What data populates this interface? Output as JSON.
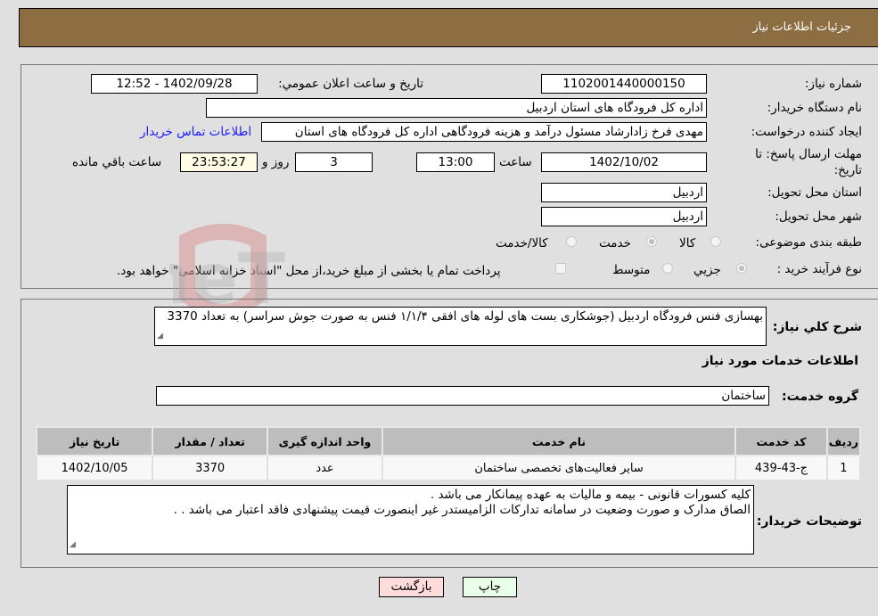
{
  "header": {
    "title": "جزئیات اطلاعات نیاز"
  },
  "fields": {
    "need_number_label": "شماره نیاز:",
    "need_number": "1102001440000150",
    "announce_label": "تاریخ و ساعت اعلان عمومي:",
    "announce_value": "1402/09/28 - 12:52",
    "buyer_org_label": "نام دستگاه خریدار:",
    "buyer_org": "اداره کل فرودگاه های استان اردبیل",
    "creator_label": "ایجاد کننده درخواست:",
    "creator": "مهدی فرخ زادارشاد مسئول درآمد و هزینه فرودگاهی اداره کل فرودگاه های استان",
    "contact_link": "اطلاعات تماس خریدار",
    "deadline_label": "مهلت ارسال پاسخ: تا تاریخ:",
    "deadline_date": "1402/10/02",
    "time_label": "ساعت",
    "deadline_time": "13:00",
    "days_value": "3",
    "days_label": "روز و",
    "remaining_time": "23:53:27",
    "remaining_label": "ساعت باقي مانده",
    "province_label": "استان محل تحویل:",
    "province": "اردبیل",
    "city_label": "شهر محل تحویل:",
    "city": "اردبیل",
    "category_label": "طبقه بندی موضوعی:",
    "category_options": [
      "کالا",
      "خدمت",
      "کالا/خدمت"
    ],
    "category_selected": "خدمت",
    "process_label": "نوع فرآیند خرید :",
    "process_options": [
      "جزيي",
      "متوسط"
    ],
    "process_selected": "جزيي",
    "treasury_note": "پرداخت تمام یا بخشی از مبلغ خرید،از محل \"اسناد خزانه اسلامی\" خواهد بود."
  },
  "description": {
    "label": "شرح کلي نیاز:",
    "text": "بهسازی فنس فرودگاه اردبیل (جوشکاری بست های لوله های افقی ۱/۱/۴ فنس به صورت جوش سراسر) به تعداد 3370"
  },
  "services": {
    "section_title": "اطلاعات خدمات مورد نیاز",
    "group_label": "گروه خدمت:",
    "group_value": "ساختمان",
    "table": {
      "headers": [
        "ردیف",
        "کد خدمت",
        "نام خدمت",
        "واحد اندازه گیری",
        "تعداد / مقدار",
        "تاریخ نیاز"
      ],
      "rows": [
        [
          "1",
          "ج-43-439",
          "سایر فعالیت‌های تخصصی ساختمان",
          "عدد",
          "3370",
          "1402/10/05"
        ]
      ]
    }
  },
  "buyer_notes": {
    "label": "توضیحات خریدار:",
    "line1": "کلیه کسورات قانونی - بیمه و مالیات به عهده پیمانکار می باشد .",
    "line2": "الصاق مدارک و صورت وضعیت در سامانه تدارکات الزامیستدر غیر اینصورت قیمت پیشنهادی فاقد اعتبار می باشد . ."
  },
  "buttons": {
    "print": "چاپ",
    "back": "بازگشت"
  },
  "watermark": {
    "text": "AriaTender.neT"
  }
}
